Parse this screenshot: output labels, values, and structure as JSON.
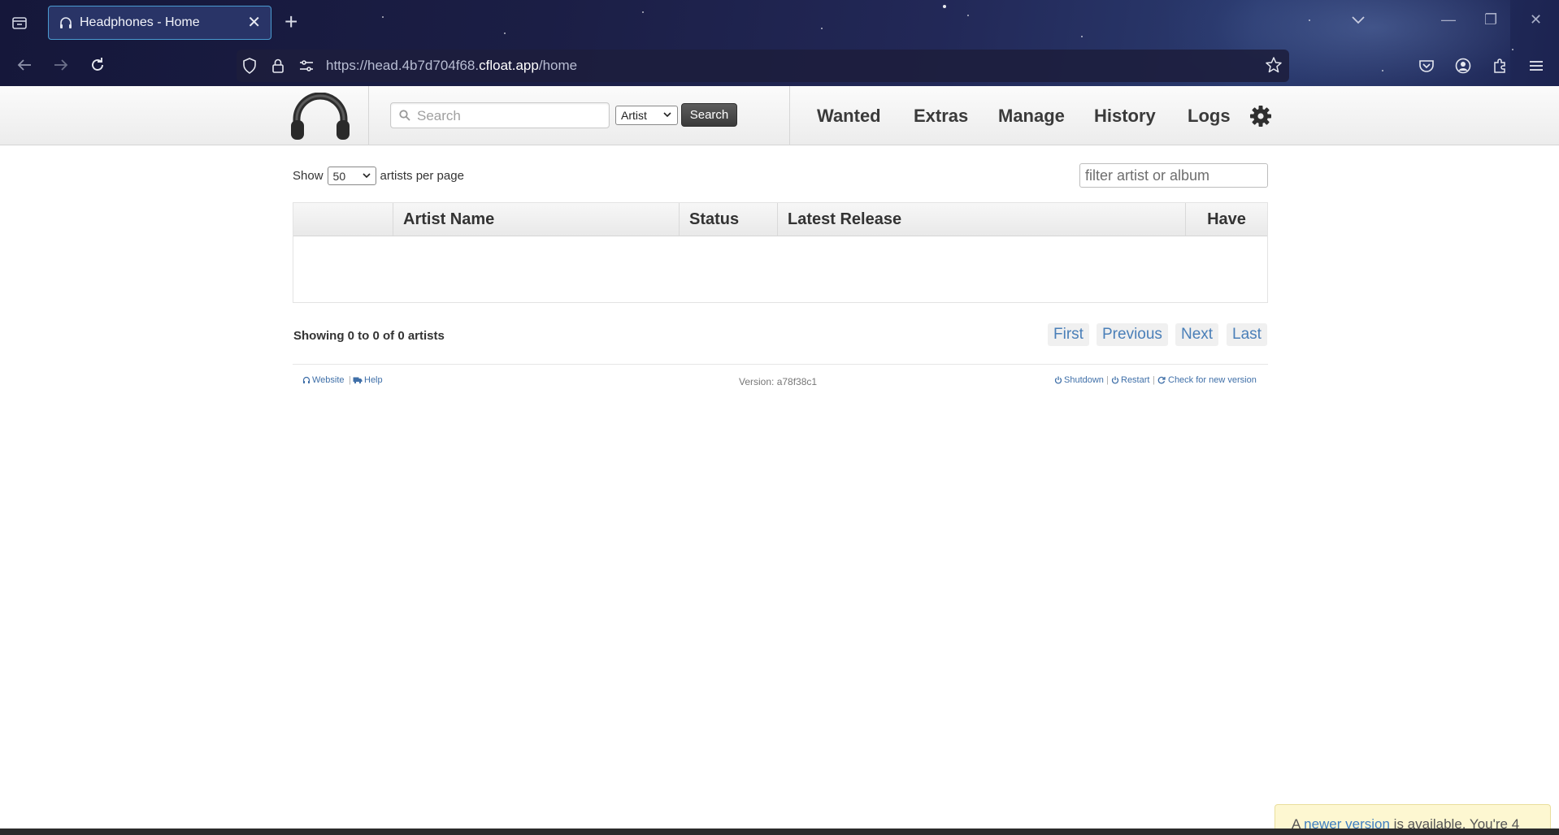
{
  "browser": {
    "tab_title": "Headphones - Home",
    "url_prefix": "https://head.4b7d704f68.",
    "url_domain": "cfloat.app",
    "url_path": "/home"
  },
  "header": {
    "search_placeholder": "Search",
    "search_type": "Artist",
    "search_button": "Search",
    "nav": [
      "Wanted",
      "Extras",
      "Manage",
      "History",
      "Logs"
    ]
  },
  "controls": {
    "show_label": "Show",
    "per_page_value": "50",
    "per_page_suffix": "artists per page",
    "filter_placeholder": "filter artist or album"
  },
  "table": {
    "columns": [
      "",
      "Artist Name",
      "Status",
      "Latest Release",
      "Have"
    ]
  },
  "pagination": {
    "showing": "Showing 0 to 0 of 0 artists",
    "first": "First",
    "previous": "Previous",
    "next": "Next",
    "last": "Last"
  },
  "footer": {
    "website": "Website",
    "help": "Help",
    "version": "Version: a78f38c1",
    "shutdown": "Shutdown",
    "restart": "Restart",
    "check_update": "Check for new version"
  },
  "notice": {
    "prefix": "A ",
    "link": "newer version",
    "suffix": " is available. You're 4"
  },
  "colors": {
    "link": "#3f6fa8",
    "search_button": "#4a4a4a",
    "notice_bg": "#fdf7d1"
  }
}
